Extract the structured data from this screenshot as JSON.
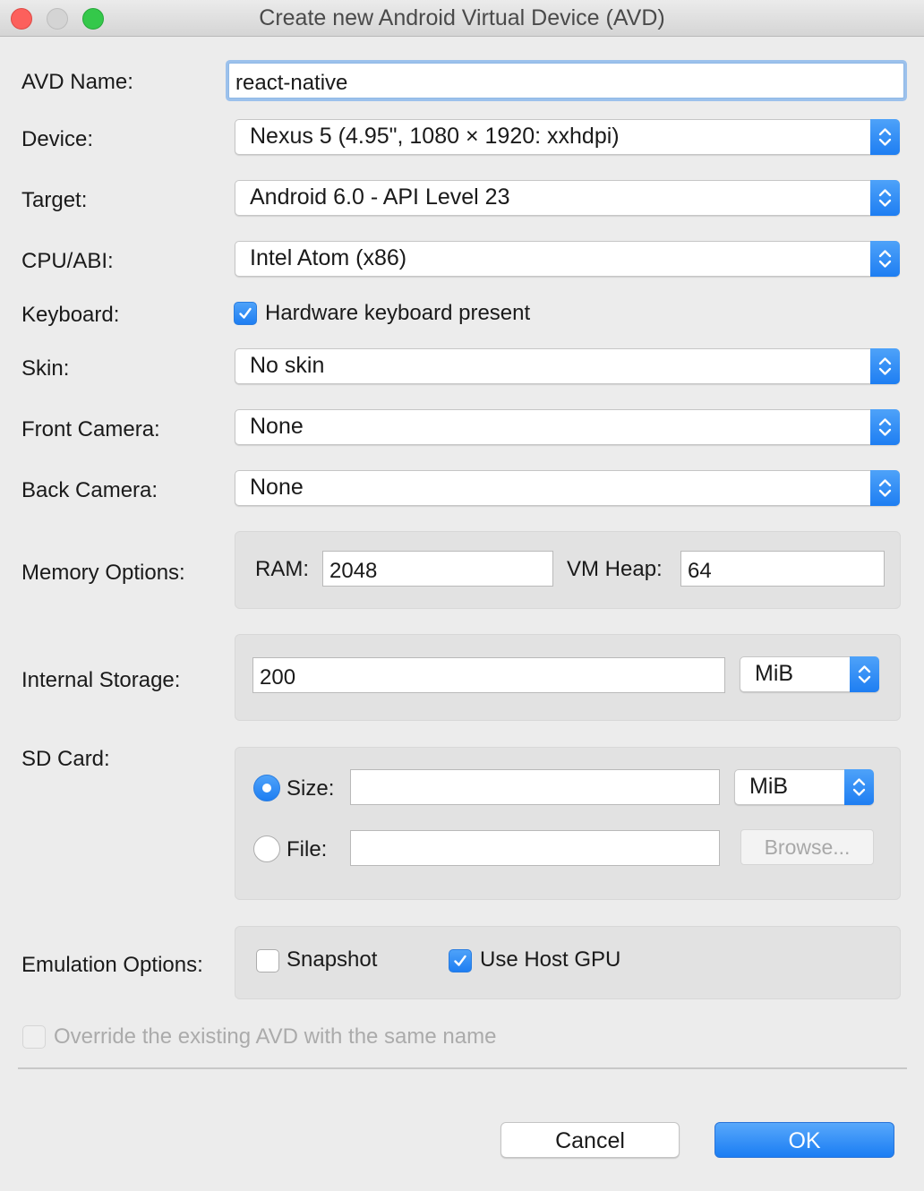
{
  "window": {
    "title": "Create new Android Virtual Device (AVD)"
  },
  "avd_name": {
    "label": "AVD Name:",
    "value": "react-native"
  },
  "device": {
    "label": "Device:",
    "value": "Nexus 5 (4.95\", 1080 × 1920: xxhdpi)"
  },
  "target": {
    "label": "Target:",
    "value": "Android 6.0 - API Level 23"
  },
  "cpu_abi": {
    "label": "CPU/ABI:",
    "value": "Intel Atom (x86)"
  },
  "keyboard": {
    "label": "Keyboard:",
    "checkbox_label": "Hardware keyboard present",
    "checked": true
  },
  "skin": {
    "label": "Skin:",
    "value": "No skin"
  },
  "front_camera": {
    "label": "Front Camera:",
    "value": "None"
  },
  "back_camera": {
    "label": "Back Camera:",
    "value": "None"
  },
  "memory": {
    "label": "Memory Options:",
    "ram_label": "RAM:",
    "ram_value": "2048",
    "vm_heap_label": "VM Heap:",
    "vm_heap_value": "64"
  },
  "internal_storage": {
    "label": "Internal Storage:",
    "value": "200",
    "unit": "MiB"
  },
  "sd_card": {
    "label": "SD Card:",
    "size_label": "Size:",
    "size_value": "",
    "size_unit": "MiB",
    "size_selected": true,
    "file_label": "File:",
    "file_value": "",
    "browse_label": "Browse..."
  },
  "emulation": {
    "label": "Emulation Options:",
    "snapshot_label": "Snapshot",
    "snapshot_checked": false,
    "host_gpu_label": "Use Host GPU",
    "host_gpu_checked": true
  },
  "override": {
    "label": "Override the existing AVD with the same name",
    "checked": false,
    "enabled": false
  },
  "buttons": {
    "cancel": "Cancel",
    "ok": "OK"
  },
  "colors": {
    "accent": "#1e7ef2",
    "window_bg": "#ececec",
    "panel_bg": "#e2e2e2",
    "close": "#fc605c",
    "maximize": "#34c84a"
  },
  "icons": {
    "popup_arrows": "up-down-chevron-icon",
    "checkmark": "checkmark-icon"
  }
}
